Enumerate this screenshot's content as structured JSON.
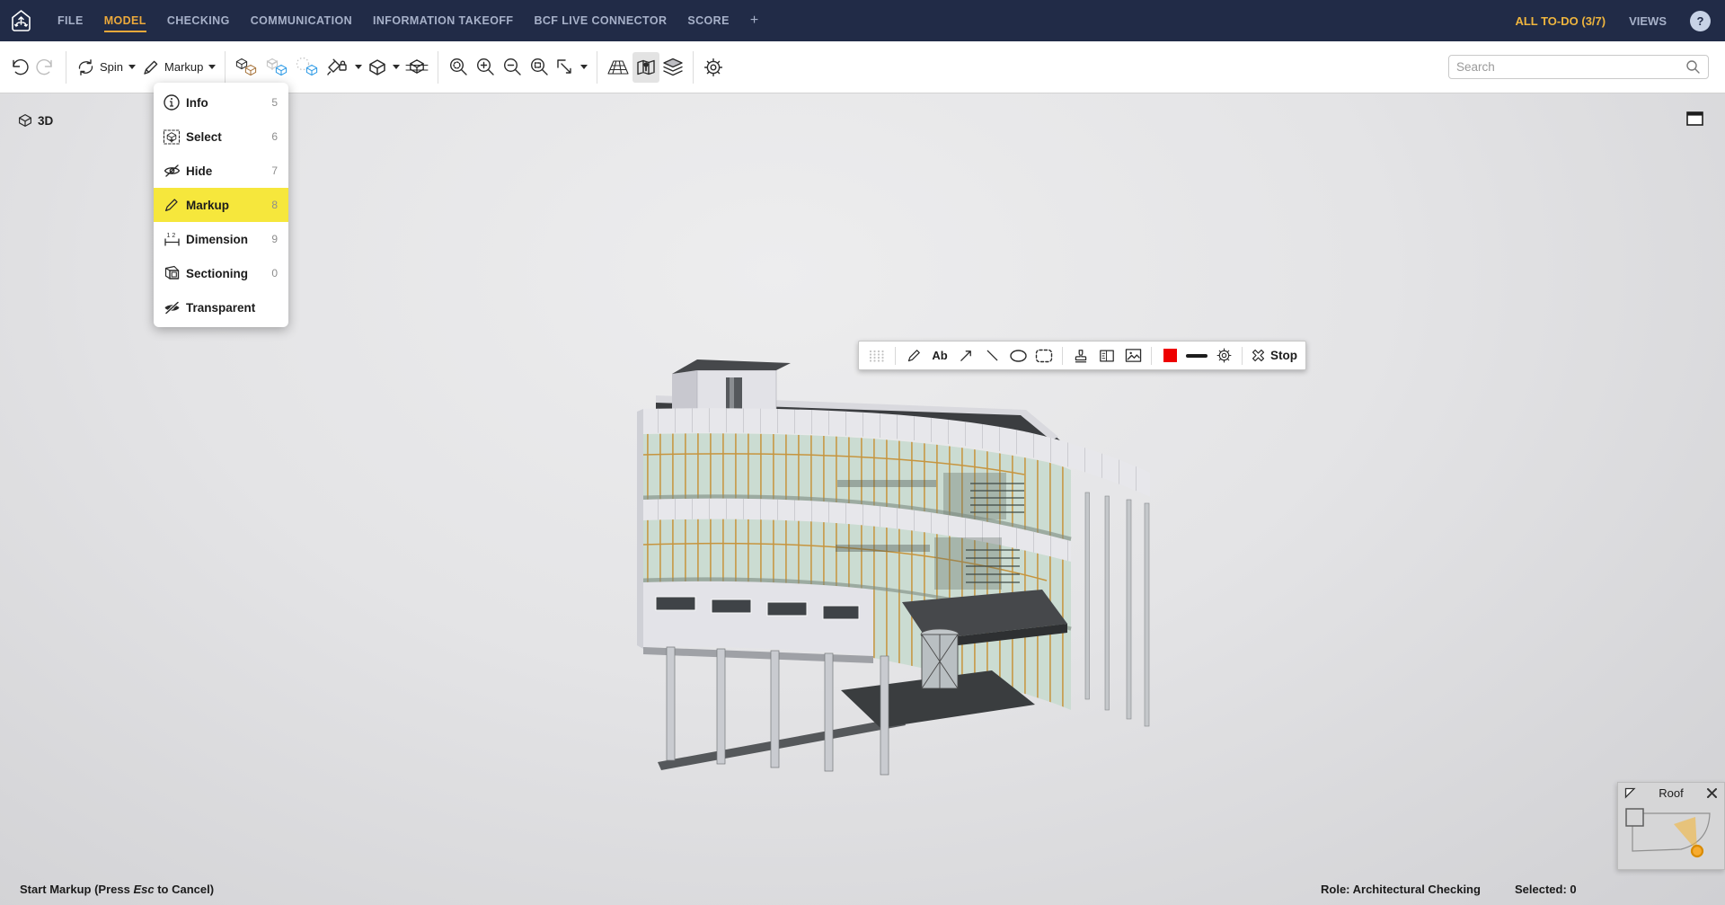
{
  "navbar": {
    "logo": "solibri-logo",
    "items": [
      {
        "label": "FILE",
        "active": false
      },
      {
        "label": "MODEL",
        "active": true
      },
      {
        "label": "CHECKING",
        "active": false
      },
      {
        "label": "COMMUNICATION",
        "active": false
      },
      {
        "label": "INFORMATION TAKEOFF",
        "active": false
      },
      {
        "label": "BCF LIVE CONNECTOR",
        "active": false
      },
      {
        "label": "SCORE",
        "active": false
      },
      {
        "label": "+",
        "active": false
      }
    ],
    "todo_label": "ALL TO-DO (3/7)",
    "views_label": "VIEWS",
    "help_label": "?"
  },
  "toolbar": {
    "spin_label": "Spin",
    "markup_label": "Markup",
    "search_placeholder": "Search"
  },
  "tool_menu": {
    "items": [
      {
        "label": "Info",
        "shortcut": "5",
        "highlighted": false
      },
      {
        "label": "Select",
        "shortcut": "6",
        "highlighted": false
      },
      {
        "label": "Hide",
        "shortcut": "7",
        "highlighted": false
      },
      {
        "label": "Markup",
        "shortcut": "8",
        "highlighted": true
      },
      {
        "label": "Dimension",
        "shortcut": "9",
        "highlighted": false
      },
      {
        "label": "Sectioning",
        "shortcut": "0",
        "highlighted": false
      },
      {
        "label": "Transparent",
        "shortcut": "",
        "highlighted": false
      }
    ]
  },
  "markup_toolbar": {
    "text_tool_label": "Ab",
    "stop_label": "Stop",
    "active_color": "#EE0000"
  },
  "viewport": {
    "view_label": "3D",
    "minimap_title": "Roof"
  },
  "statusbar": {
    "hint_prefix": "Start Markup (Press ",
    "hint_key": "Esc",
    "hint_suffix": " to Cancel)",
    "role": "Role: Architectural Checking",
    "selected": "Selected: 0"
  },
  "colors": {
    "navbar_bg": "#212B47",
    "accent_gold": "#ECA93B",
    "todo_gold": "#EFB53E",
    "menu_highlight_yellow": "#F6E73C",
    "markup_red": "#EE0000",
    "cube_blue": "#2E9BE6",
    "cube_brown": "#A8763E",
    "mullion_tan": "#C6953F"
  }
}
